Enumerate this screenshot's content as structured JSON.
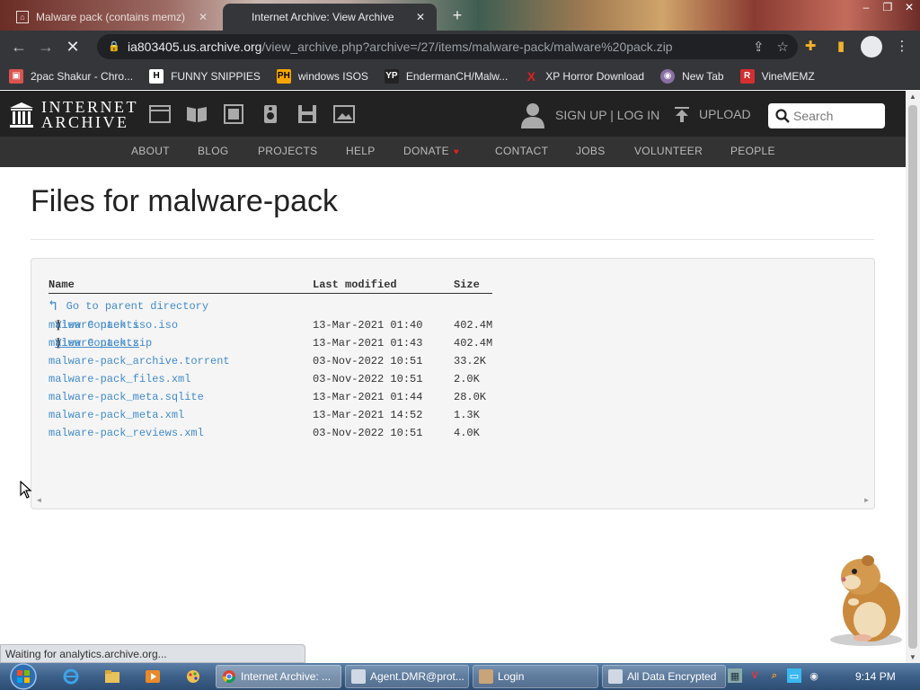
{
  "browser": {
    "tabs": [
      {
        "title": "Malware pack (contains memz)",
        "active": false
      },
      {
        "title": "Internet Archive: View Archive",
        "active": true
      }
    ],
    "url": {
      "host": "ia803405.us.archive.org",
      "path": "/view_archive.php?archive=/27/items/malware-pack/malware%20pack.zip"
    },
    "bookmarks": [
      {
        "label": "2pac Shakur - Chro...",
        "icon": "image-icon"
      },
      {
        "label": "FUNNY SNIPPIES",
        "icon": "H"
      },
      {
        "label": "windows ISOS",
        "icon": "PH"
      },
      {
        "label": "EndermanCH/Malw...",
        "icon": "YP"
      },
      {
        "label": "XP Horror Download",
        "icon": "X"
      },
      {
        "label": "New Tab",
        "icon": "globe-icon"
      },
      {
        "label": "VineMEMZ",
        "icon": "R"
      }
    ],
    "status_text": "Waiting for analytics.archive.org..."
  },
  "ia_header": {
    "logo_line1": "INTERNET",
    "logo_line2": "ARCHIVE",
    "signup_label": "SIGN UP | LOG IN",
    "upload_label": "UPLOAD",
    "search_placeholder": "Search",
    "nav": [
      "ABOUT",
      "BLOG",
      "PROJECTS",
      "HELP",
      "DONATE",
      "CONTACT",
      "JOBS",
      "VOLUNTEER",
      "PEOPLE"
    ]
  },
  "page": {
    "title": "Files for malware-pack",
    "columns": {
      "name": "Name",
      "modified": "Last modified",
      "size": "Size"
    },
    "parent_link": "Go to parent directory",
    "files": [
      {
        "name": "malware pack iso.iso",
        "view": "View Contents",
        "date": "13-Mar-2021 01:40",
        "size": "402.4M"
      },
      {
        "name": "malware pack.zip",
        "view": "View Contents",
        "date": "13-Mar-2021 01:43",
        "size": "402.4M"
      },
      {
        "name": "malware-pack_archive.torrent",
        "view": "",
        "date": "03-Nov-2022 10:51",
        "size": "33.2K"
      },
      {
        "name": "malware-pack_files.xml",
        "view": "",
        "date": "03-Nov-2022 10:51",
        "size": "2.0K"
      },
      {
        "name": "malware-pack_meta.sqlite",
        "view": "",
        "date": "13-Mar-2021 01:44",
        "size": "28.0K"
      },
      {
        "name": "malware-pack_meta.xml",
        "view": "",
        "date": "13-Mar-2021 14:52",
        "size": "1.3K"
      },
      {
        "name": "malware-pack_reviews.xml",
        "view": "",
        "date": "03-Nov-2022 10:51",
        "size": "4.0K"
      }
    ]
  },
  "taskbar": {
    "windows": [
      {
        "label": "Internet Archive: ...",
        "active": true
      },
      {
        "label": "Agent.DMR@prot...",
        "active": false
      },
      {
        "label": "Login",
        "active": false
      },
      {
        "label": "All Data Encrypted",
        "active": false
      }
    ],
    "clock": "9:14 PM"
  },
  "colors": {
    "link": "#428bca",
    "ia_dark": "#222222",
    "ia_nav": "#333333",
    "chrome_dark": "#35363a",
    "donate_heart": "#e02020"
  }
}
